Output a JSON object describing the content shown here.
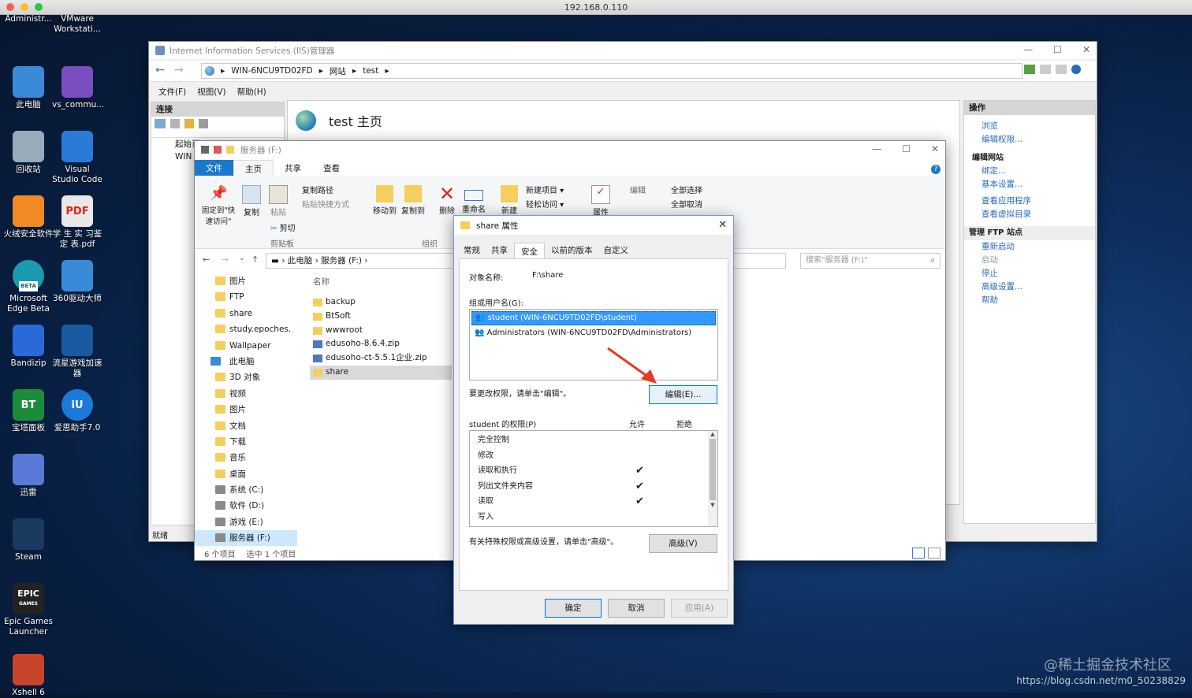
{
  "mac": {
    "title": "192.168.0.110"
  },
  "desktop": {
    "icons": [
      {
        "label": "Administr...",
        "icon": "user-folder-icon"
      },
      {
        "label": "VMware Workstati...",
        "icon": "vmware-icon"
      },
      {
        "label": "此电脑",
        "icon": "computer-icon"
      },
      {
        "label": "vs_commu...",
        "icon": "visual-studio-icon"
      },
      {
        "label": "回收站",
        "icon": "recycle-bin-icon"
      },
      {
        "label": "Visual Studio Code",
        "icon": "vscode-icon"
      },
      {
        "label": "火绒安全软件",
        "icon": "huorong-icon"
      },
      {
        "label": "学 生 实 习鉴 定 表.pdf",
        "icon": "pdf-icon"
      },
      {
        "label": "Microsoft Edge Beta",
        "icon": "edge-beta-icon"
      },
      {
        "label": "360驱动大师",
        "icon": "driver-icon"
      },
      {
        "label": "Bandizip",
        "icon": "bandizip-icon"
      },
      {
        "label": "流星游戏加速器",
        "icon": "accelerator-icon"
      },
      {
        "label": "宝塔面板",
        "icon": "bt-panel-icon"
      },
      {
        "label": "爱思助手7.0",
        "icon": "i4-icon"
      },
      {
        "label": "迅雷",
        "icon": "thunder-icon"
      },
      {
        "label": "Steam",
        "icon": "steam-icon"
      },
      {
        "label": "Epic Games Launcher",
        "icon": "epic-icon"
      },
      {
        "label": "Xshell 6",
        "icon": "xshell-icon"
      }
    ],
    "badges": {
      "edge": "BETA",
      "pdf": "PDF",
      "bt": "BT",
      "epic": "EPIC",
      "epic_sub": "GAMES",
      "i4": "iU"
    }
  },
  "iis": {
    "title": "Internet Information Services (IIS)管理器",
    "breadcrumb": [
      "WIN-6NCU9TD02FD",
      "网站",
      "test"
    ],
    "menu": [
      "文件(F)",
      "视图(V)",
      "帮助(H)"
    ],
    "connections_header": "连接",
    "tree": [
      "起始页",
      "WIN"
    ],
    "main_title": "test 主页",
    "actions_header": "操作",
    "actions": [
      "浏览",
      "编辑权限..."
    ],
    "edit_site_header": "编辑网站",
    "edit_site": [
      "绑定...",
      "基本设置..."
    ],
    "site_links": [
      "查看应用程序",
      "查看虚拟目录"
    ],
    "ftp_header": "管理 FTP 站点",
    "ftp_actions": [
      "重新启动",
      "启动",
      "停止"
    ],
    "advanced": "高级设置...",
    "help": "帮助",
    "status": "就绪"
  },
  "explorer": {
    "title": "服务器 (F:)",
    "ribbon_tabs": [
      "文件",
      "主页",
      "共享",
      "查看"
    ],
    "ribbon": {
      "pin": "固定到\"快速访问\"",
      "copy": "复制",
      "paste": "粘贴",
      "copy_path": "复制路径",
      "paste_shortcut": "粘贴快捷方式",
      "cut": "剪切",
      "clipboard": "剪贴板",
      "move_to": "移动到",
      "copy_to": "复制到",
      "delete": "删除",
      "rename": "重命名",
      "organize": "组织",
      "new_folder": "新建",
      "new_item": "新建项目",
      "easy_access": "轻松访问",
      "properties": "属性",
      "edit": "编辑",
      "select_all": "全部选择",
      "select_none": "全部取消"
    },
    "path": [
      "此电脑",
      "服务器 (F:)"
    ],
    "search_placeholder": "搜索\"服务器 (F:)\"",
    "column_name": "名称",
    "nav": [
      "图片",
      "FTP",
      "share",
      "study.epoches.",
      "Wallpaper",
      "此电脑",
      "3D 对象",
      "视频",
      "图片",
      "文档",
      "下载",
      "音乐",
      "桌面",
      "系统 (C:)",
      "软件 (D:)",
      "游戏 (E:)",
      "服务器 (F:)"
    ],
    "files": [
      "backup",
      "BtSoft",
      "wwwroot",
      "edusoho-8.6.4.zip",
      "edusoho-ct-5.5.1企业.zip",
      "share"
    ],
    "status_count": "6 个项目",
    "status_selected": "选中 1 个项目"
  },
  "dialog": {
    "title": "share 属性",
    "tabs": [
      "常规",
      "共享",
      "安全",
      "以前的版本",
      "自定义"
    ],
    "object_label": "对象名称:",
    "object_value": "F:\\share",
    "group_label": "组或用户名(G):",
    "users": [
      "student (WIN-6NCU9TD02FD\\student)",
      "Administrators (WIN-6NCU9TD02FD\\Administrators)"
    ],
    "change_hint": "要更改权限，请单击\"编辑\"。",
    "edit_button": "编辑(E)...",
    "perm_label": "student 的权限(P)",
    "allow": "允许",
    "deny": "拒绝",
    "permissions": [
      {
        "name": "完全控制",
        "allow": false
      },
      {
        "name": "修改",
        "allow": false
      },
      {
        "name": "读取和执行",
        "allow": true
      },
      {
        "name": "列出文件夹内容",
        "allow": true
      },
      {
        "name": "读取",
        "allow": true
      },
      {
        "name": "写入",
        "allow": false
      }
    ],
    "check_glyph": "✔",
    "special_hint": "有关特殊权限或高级设置，请单击\"高级\"。",
    "advanced_button": "高级(V)",
    "ok": "确定",
    "cancel": "取消",
    "apply": "应用(A)"
  },
  "watermark": {
    "line1": "@稀土掘金技术社区",
    "line2": "https://blog.csdn.net/m0_50238829"
  },
  "colors": {
    "accent": "#0078d7",
    "selection": "#3399ff",
    "arrow": "#e53a23"
  }
}
